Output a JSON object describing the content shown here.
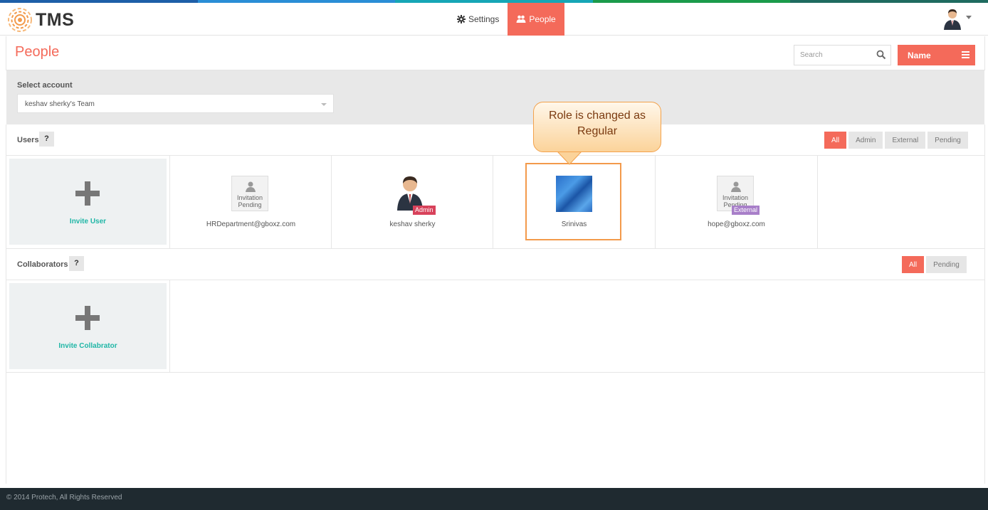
{
  "colors": {
    "accent": "#f46a5a",
    "link": "#1fb6a6",
    "strip": [
      "#1e5fa8",
      "#2a8ed6",
      "#16a6b6",
      "#1b9b4b",
      "#1f6b60"
    ]
  },
  "header": {
    "logo_text": "TMS",
    "nav": [
      {
        "label": "Settings",
        "icon": "gear-icon"
      },
      {
        "label": "People",
        "icon": "users-icon"
      }
    ]
  },
  "toolbar": {
    "title": "People",
    "search_placeholder": "Search",
    "sort_label": "Name"
  },
  "account": {
    "label": "Select account",
    "selected": "keshav sherky's Team"
  },
  "users": {
    "title": "Users",
    "help": "?",
    "filters": [
      "All",
      "Admin",
      "External",
      "Pending"
    ],
    "invite_label": "Invite User",
    "cards": [
      {
        "name": "HRDepartment@gboxz.com",
        "pending_text": "Invitation Pending"
      },
      {
        "name": "keshav sherky",
        "badge": "Admin"
      },
      {
        "name": "Srinivas"
      },
      {
        "name": "hope@gboxz.com",
        "pending_text": "Invitation Pending",
        "badge": "External"
      }
    ]
  },
  "collaborators": {
    "title": "Collaborators",
    "help": "?",
    "filters": [
      "All",
      "Pending"
    ],
    "invite_label": "Invite Collabrator"
  },
  "callout": {
    "line1": "Role is changed as",
    "line2": "Regular"
  },
  "footer": {
    "text": "© 2014 Protech, All Rights Reserved"
  }
}
